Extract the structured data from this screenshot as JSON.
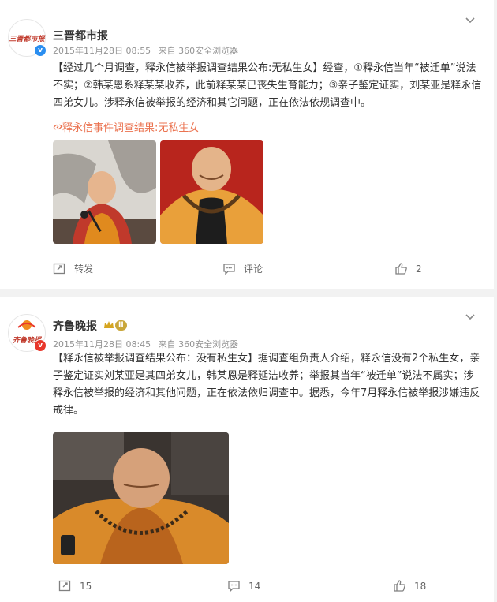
{
  "posts": [
    {
      "username": "三晋都市报",
      "avatar_text": "三晋都市报",
      "date": "2015年11月28日 08:55",
      "source": "来自 360安全浏览器",
      "content": "【经过几个月调查，释永信被举报调查结果公布:无私生女】经查，①释永信当年“被迁单”说法不实；②韩某恩系释某某收养，此前释某某已丧失生育能力；③亲子鉴定证实，刘某亚是释永信四弟女儿。涉释永信被举报的经济和其它问题，正在依法依规调查中。",
      "topic": "释永信事件调查结果:无私生女",
      "actions": {
        "repost": "转发",
        "comment": "评论",
        "like": "2"
      },
      "colors": {
        "verified_badge": "#2a8ef0",
        "topic": "#eb7350"
      }
    },
    {
      "username": "齐鲁晚报",
      "avatar_text": "齐鲁晚报",
      "vip_level": "II",
      "date": "2015年11月28日 08:45",
      "source": "来自 360安全浏览器",
      "content": "【释永信被举报调查结果公布：没有私生女】据调查组负责人介绍，释永信没有2个私生女，亲子鉴定证实刘某亚是其四弟女儿，韩某恩是释延洁收养；举报其当年“被迁单”说法不属实；涉释永信被举报的经济和其他问题，正在依法依归调查中。据悉，今年7月释永信被举报涉嫌违反戒律。",
      "actions": {
        "repost": "15",
        "comment": "14",
        "like": "18"
      },
      "colors": {
        "verified_badge": "#e8372b"
      }
    }
  ]
}
